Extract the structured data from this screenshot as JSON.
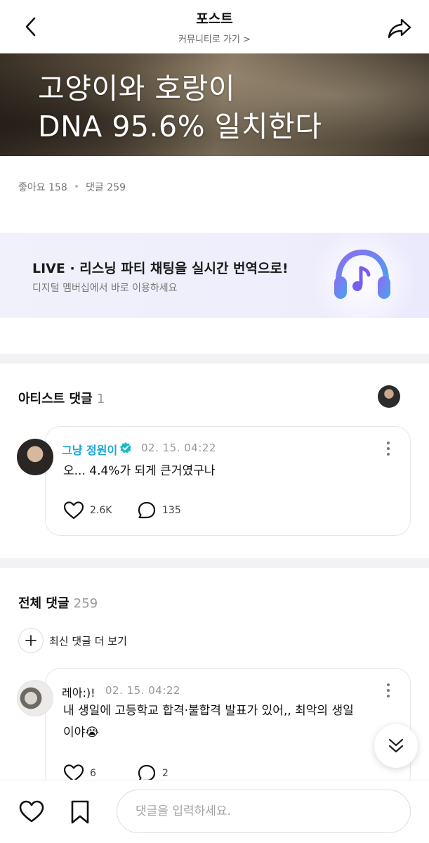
{
  "header": {
    "title": "포스트",
    "community_link": "커뮤니티로 가기 >"
  },
  "post": {
    "image_text_line1": "고양이와 호랑이",
    "image_text_line2": "DNA 95.6% 일치한다",
    "likes": "좋아요 158",
    "separator": "•",
    "comments": "댓글 259"
  },
  "banner": {
    "title": "LIVE · 리스닝 파티 채팅을 실시간 번역으로!",
    "subtitle": "디지털 멤버십에서 바로 이용하세요"
  },
  "artist_comments": {
    "heading": "아티스트 댓글",
    "count": "1",
    "items": [
      {
        "author": "그냥 정원이",
        "timestamp": "02. 15. 04:22",
        "text": "오... 4.4%가 되게 큰거였구나",
        "likes": "2.6K",
        "replies": "135"
      }
    ]
  },
  "all_comments": {
    "heading": "전체 댓글",
    "count": "259",
    "more_latest": "최신 댓글 더 보기",
    "items": [
      {
        "author": "레아:)!",
        "timestamp": "02. 15. 04:22",
        "text": "내 생일에 고등학교 합격·불합격 발표가 있어,, 최악의 생일이야😭",
        "likes": "6",
        "replies": "2"
      }
    ]
  },
  "bottom_bar": {
    "input_placeholder": "댓글을 입력하세요."
  },
  "icons": {
    "back": "chevron-left-icon",
    "share": "share-icon",
    "verified": "verified-badge-icon",
    "heart": "heart-icon",
    "reply": "speech-bubble-icon",
    "more": "more-vertical-icon",
    "plus": "plus-icon",
    "scroll": "double-chevron-down-icon",
    "bookmark": "bookmark-icon",
    "banner": "headphones-music-icon"
  },
  "colors": {
    "artist_name": "#1aa7d8",
    "verified_badge": "#1bb8c9",
    "banner_bg": "#eeeefc",
    "headphone_gradient_start": "#8c6cf2",
    "headphone_gradient_end": "#4aa3f0"
  }
}
